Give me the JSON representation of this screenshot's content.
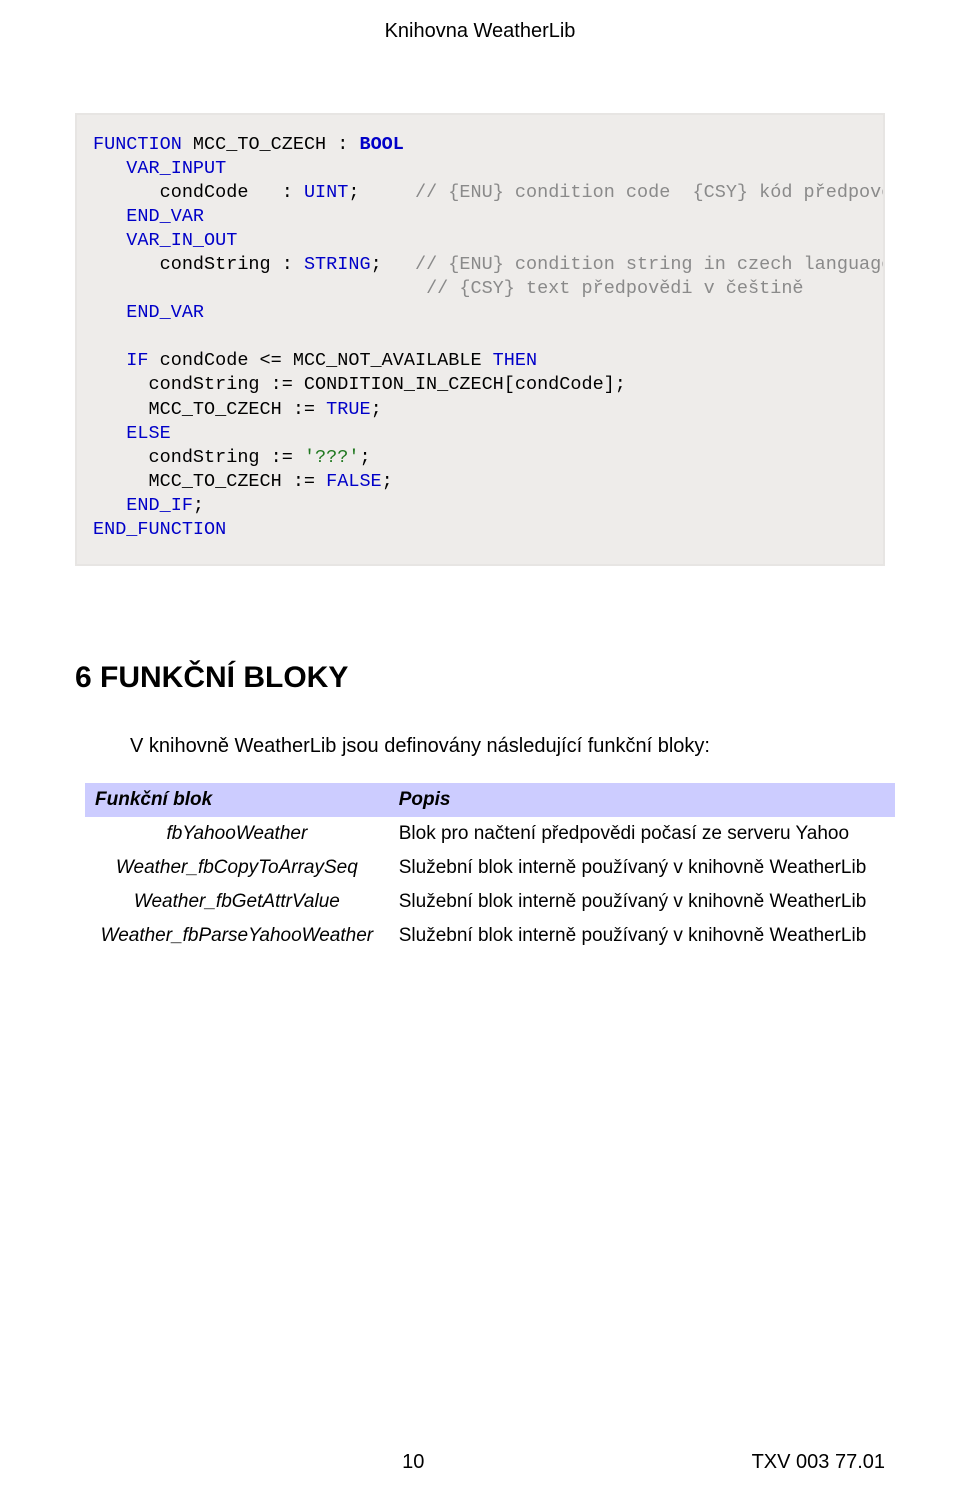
{
  "header_title": "Knihovna WeatherLib",
  "code": {
    "t1a": "FUNCTION",
    "t1b": " MCC_TO_CZECH : ",
    "t1c": "BOOL",
    "t2a": "   VAR_INPUT",
    "t3a": "      condCode   : ",
    "t3b": "UINT",
    "t3c": ";     ",
    "t3d": "// {ENU} condition code  {CSY} kód předpovědi",
    "t4a": "   END_VAR",
    "t5a": "   VAR_IN_OUT",
    "t6a": "      condString : ",
    "t6b": "STRING",
    "t6c": ";   ",
    "t6d": "// {ENU} condition string in czech language",
    "t7a": "                              ",
    "t7b": "// {CSY} text předpovědi v češtině",
    "t8a": "   END_VAR",
    "blank1": "",
    "t9a": "   IF",
    "t9b": " condCode <= MCC_NOT_AVAILABLE ",
    "t9c": "THEN",
    "t10": "     condString := CONDITION_IN_CZECH[condCode];",
    "t11a": "     MCC_TO_CZECH := ",
    "t11b": "TRUE",
    "t11c": ";",
    "t12a": "   ELSE",
    "t13a": "     condString := ",
    "t13b": "'???'",
    "t13c": ";",
    "t14a": "     MCC_TO_CZECH := ",
    "t14b": "FALSE",
    "t14c": ";",
    "t15a": "   END_IF",
    "t15b": ";",
    "t16a": "END_FUNCTION"
  },
  "section_heading": "6   FUNKČNÍ BLOKY",
  "intro_text": "V knihovně WeatherLib jsou definovány následující funkční bloky:",
  "table": {
    "headers": [
      "Funkční blok",
      "Popis"
    ],
    "rows": [
      {
        "name": "fbYahooWeather",
        "desc": "Blok pro načtení předpovědi počasí ze serveru Yahoo"
      },
      {
        "name": "Weather_fbCopyToArraySeq",
        "desc": "Služební blok interně používaný v knihovně WeatherLib"
      },
      {
        "name": "Weather_fbGetAttrValue",
        "desc": "Služební blok interně používaný v knihovně WeatherLib"
      },
      {
        "name": "Weather_fbParseYahooWeather",
        "desc": "Služební blok interně používaný v knihovně WeatherLib"
      }
    ]
  },
  "footer": {
    "page": "10",
    "doc": "TXV 003 77.01"
  }
}
